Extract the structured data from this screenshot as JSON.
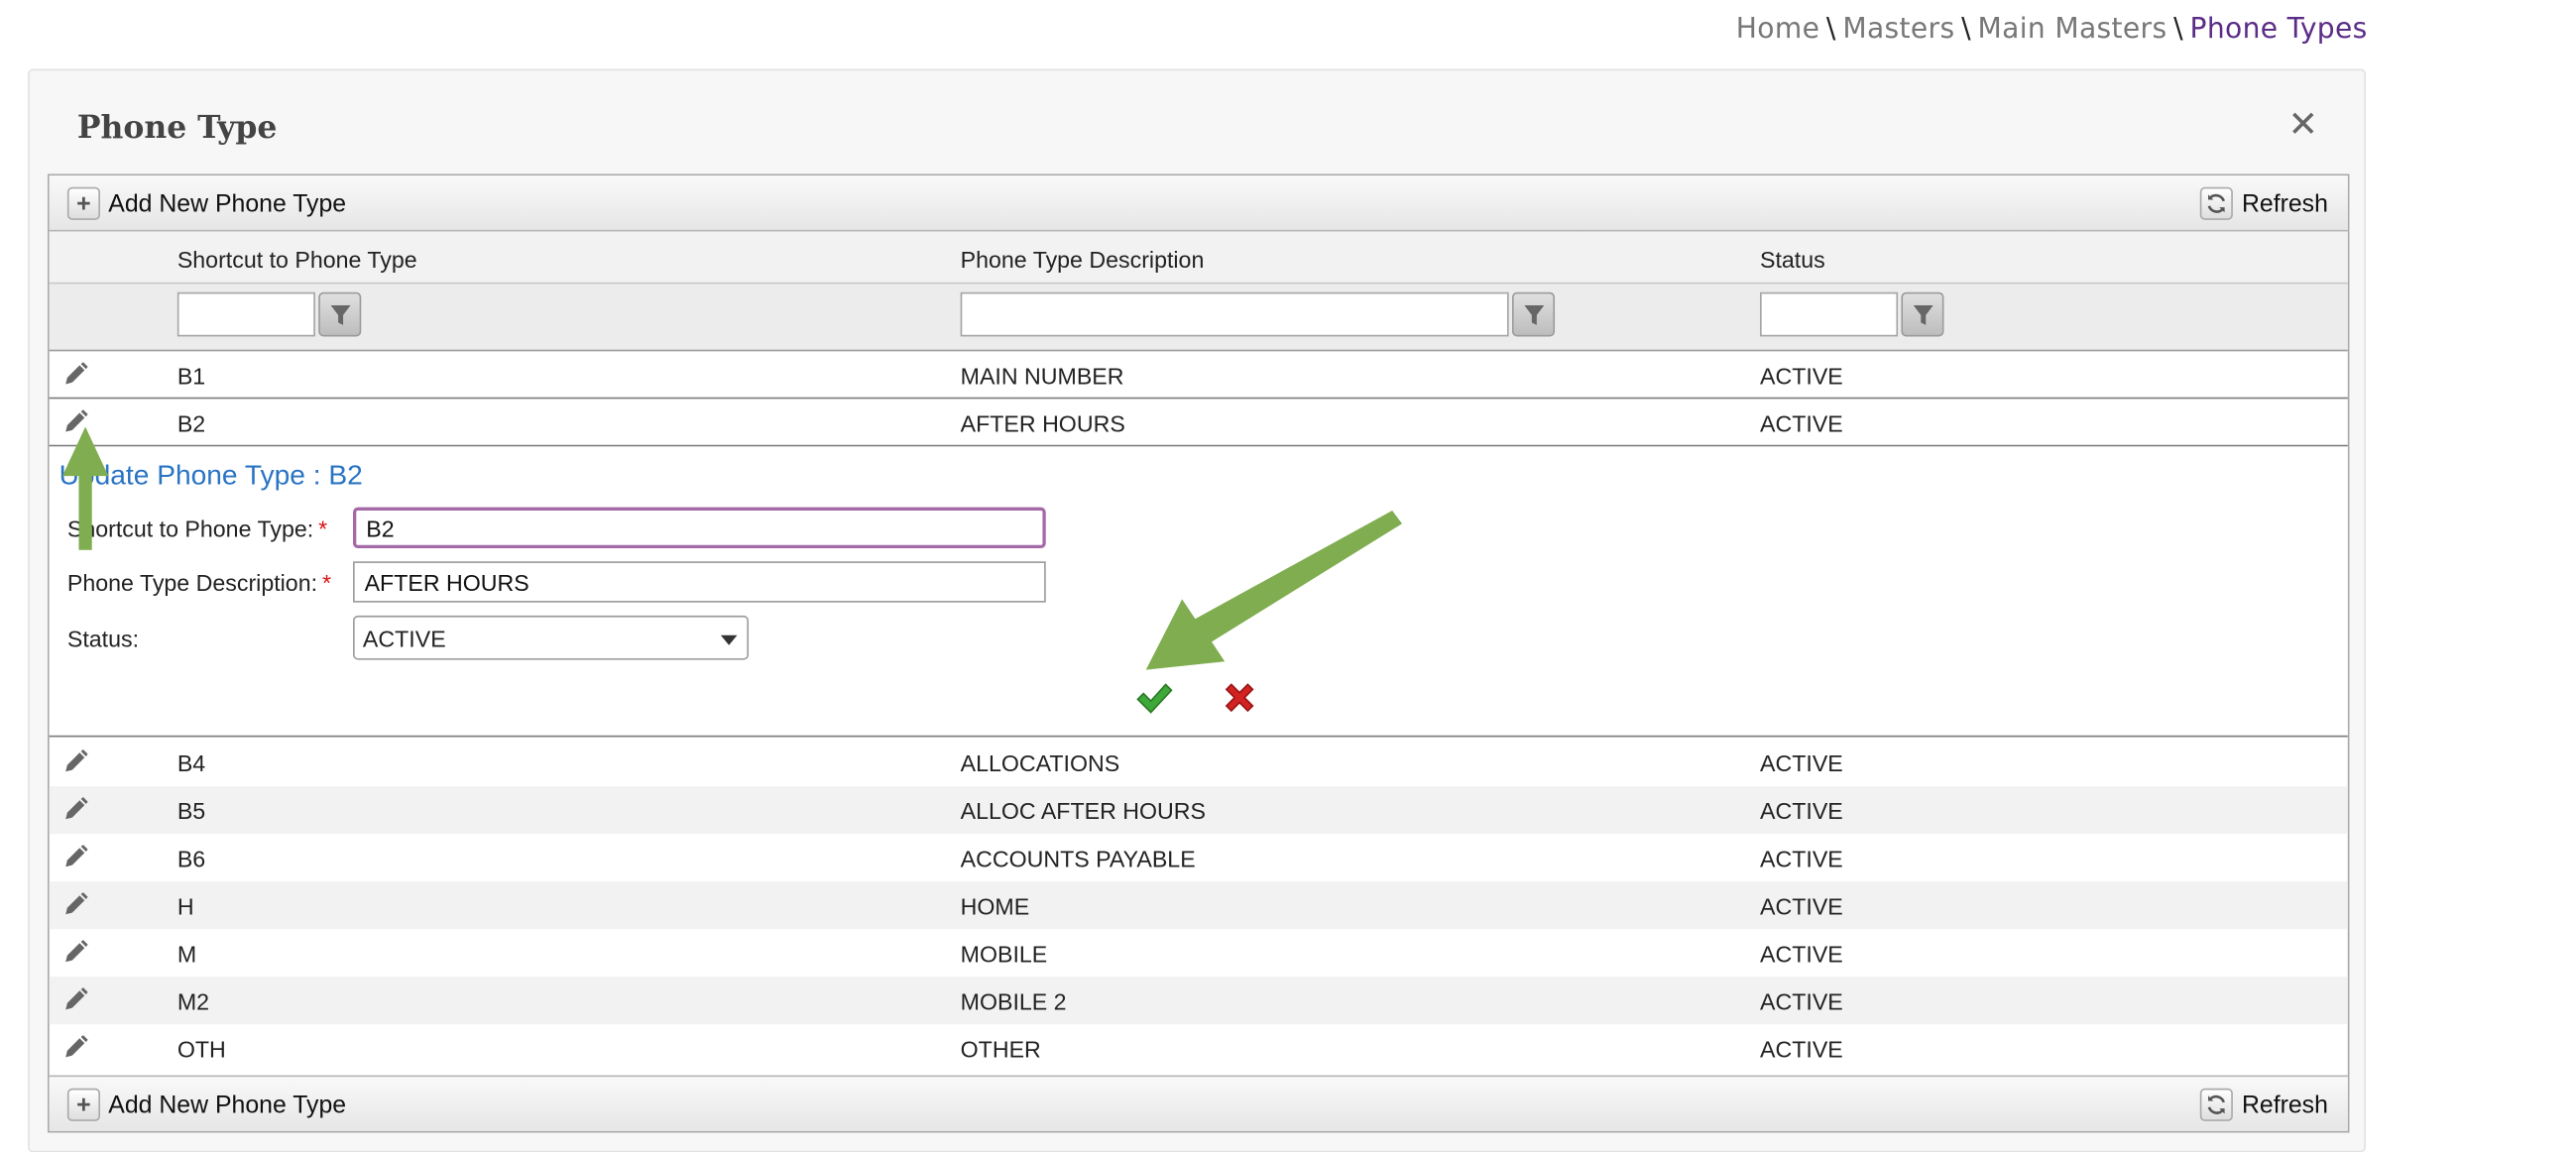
{
  "breadcrumb": {
    "items": [
      "Home",
      "Masters",
      "Main Masters"
    ],
    "current": "Phone Types",
    "separator": "\\"
  },
  "panel": {
    "title": "Phone Type",
    "close_icon": "close-icon"
  },
  "toolbar": {
    "add_label": "Add New Phone Type",
    "refresh_label": "Refresh"
  },
  "columns": {
    "shortcut": "Shortcut to Phone Type",
    "description": "Phone Type Description",
    "status": "Status"
  },
  "filters": {
    "shortcut": "",
    "description": "",
    "status": ""
  },
  "rows_top": [
    {
      "shortcut": "B1",
      "description": "MAIN NUMBER",
      "status": "ACTIVE"
    },
    {
      "shortcut": "B2",
      "description": "AFTER HOURS",
      "status": "ACTIVE"
    }
  ],
  "edit_form": {
    "title": "Update Phone Type : B2",
    "shortcut_label": "Shortcut to Phone Type:",
    "shortcut_value": "B2",
    "description_label": "Phone Type Description:",
    "description_value": "AFTER HOURS",
    "status_label": "Status:",
    "status_value": "ACTIVE",
    "required_mark": "*"
  },
  "rows_bottom": [
    {
      "shortcut": "B4",
      "description": "ALLOCATIONS",
      "status": "ACTIVE"
    },
    {
      "shortcut": "B5",
      "description": "ALLOC AFTER HOURS",
      "status": "ACTIVE"
    },
    {
      "shortcut": "B6",
      "description": "ACCOUNTS PAYABLE",
      "status": "ACTIVE"
    },
    {
      "shortcut": "H",
      "description": "HOME",
      "status": "ACTIVE"
    },
    {
      "shortcut": "M",
      "description": "MOBILE",
      "status": "ACTIVE"
    },
    {
      "shortcut": "M2",
      "description": "MOBILE 2",
      "status": "ACTIVE"
    },
    {
      "shortcut": "OTH",
      "description": "OTHER",
      "status": "ACTIVE"
    }
  ],
  "colors": {
    "breadcrumb_current": "#5b2d86",
    "form_title": "#2a74c4",
    "annotation_arrow": "#7fad4f",
    "save": "#3fa83a",
    "cancel": "#d22222"
  }
}
